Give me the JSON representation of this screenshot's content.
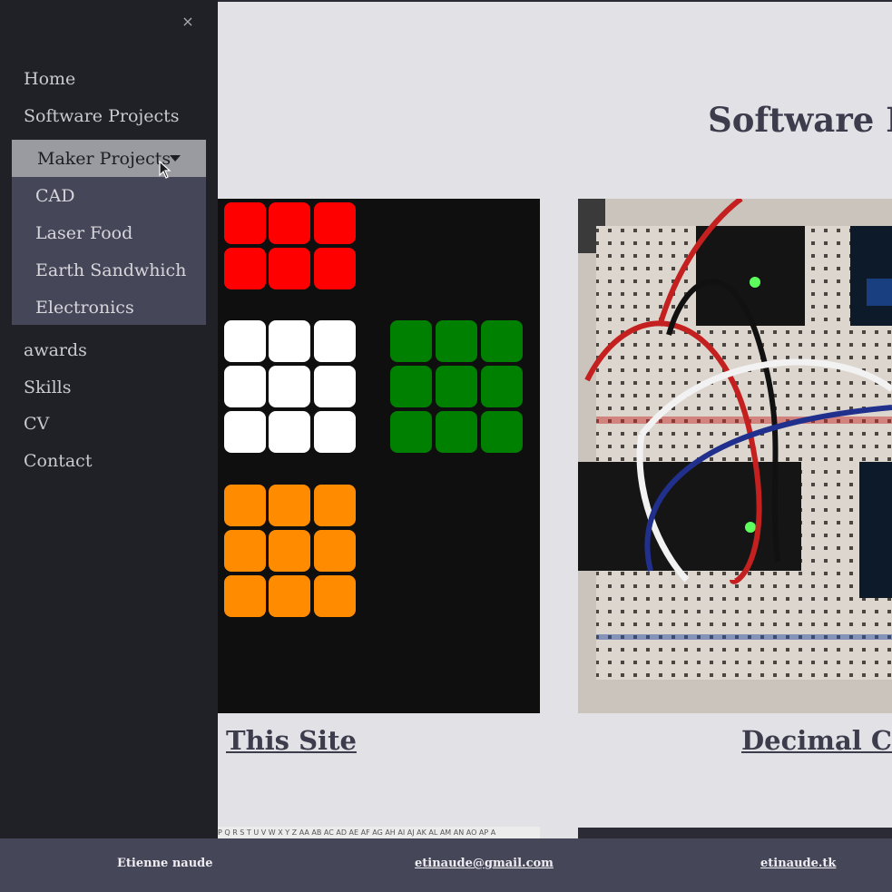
{
  "sidebar": {
    "close_label": "×",
    "items": [
      "Home",
      "Software Projects"
    ],
    "dropdown": {
      "label": "Maker Projects",
      "items": [
        "CAD",
        "Laser Food",
        "Earth Sandwhich",
        "Electronics"
      ]
    },
    "items_after": [
      "awards",
      "Skills",
      "CV",
      "Contact"
    ]
  },
  "main": {
    "title": "Software P",
    "cards": [
      {
        "title": "This Site"
      },
      {
        "title": "Decimal Clo"
      }
    ],
    "strip_text": "P Q R S T U V W X Y Z AA AB AC AD AE AF AG AH AI AJ AK AL AM AN AO AP A"
  },
  "footer": {
    "name": "Etienne naude",
    "email": "etinaude@gmail.com",
    "site": "etinaude.tk"
  },
  "colors": {
    "sidebar_bg": "#202027",
    "dropdown_bg": "#464659",
    "dropdown_active": "#9a9aa1",
    "main_bg": "#e2e1e6",
    "footer_bg": "#464659",
    "title_text": "#3c3c4c"
  }
}
